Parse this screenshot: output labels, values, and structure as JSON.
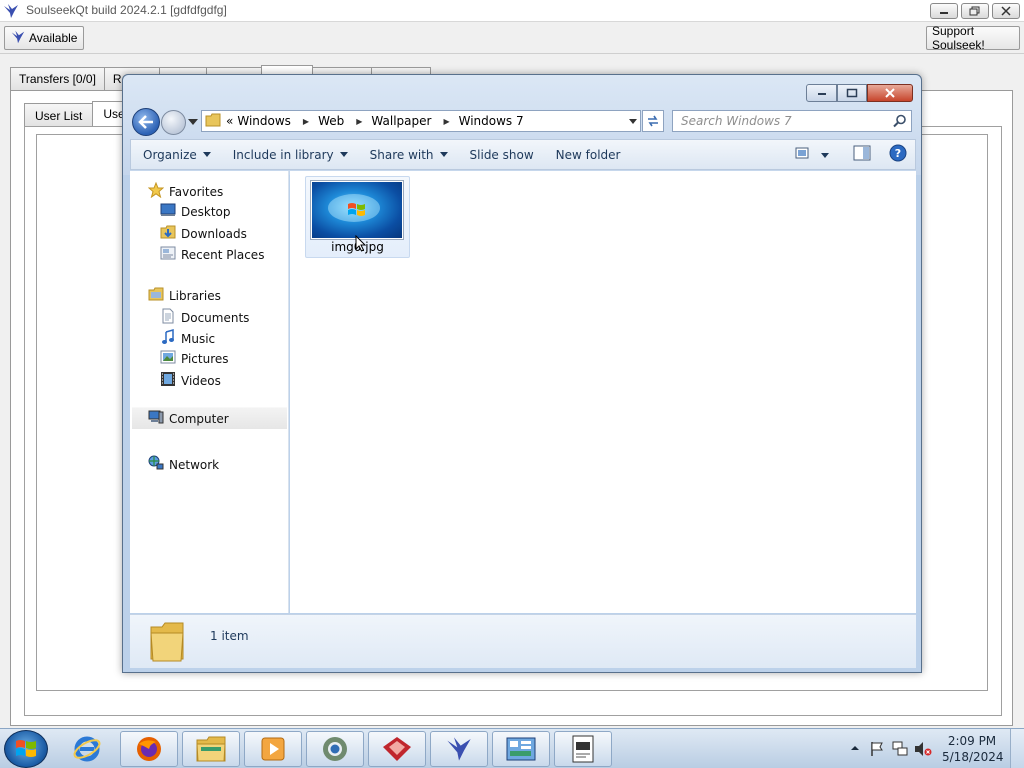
{
  "soulseek": {
    "title": "SoulseekQt build 2024.2.1 [gdfdfgdfg]",
    "available_label": "Available",
    "support_label": "Support Soulseek!",
    "tabs": [
      {
        "label": "Transfers [0/0]"
      },
      {
        "label": "R"
      },
      {
        "label": ""
      },
      {
        "label": ""
      },
      {
        "label": ""
      },
      {
        "label": ""
      },
      {
        "label": ""
      }
    ],
    "subtabs": [
      {
        "label": "User List"
      },
      {
        "label": "User"
      }
    ]
  },
  "explorer": {
    "breadcrumb": [
      "Windows",
      "Web",
      "Wallpaper",
      "Windows 7"
    ],
    "breadcrumb_prefix": "«",
    "search_placeholder": "Search Windows 7",
    "commands": {
      "organize": "Organize",
      "include_in_library": "Include in library",
      "share_with": "Share with",
      "slide_show": "Slide show",
      "new_folder": "New folder"
    },
    "nav": {
      "favorites": "Favorites",
      "desktop": "Desktop",
      "downloads": "Downloads",
      "recent_places": "Recent Places",
      "libraries": "Libraries",
      "documents": "Documents",
      "music": "Music",
      "pictures": "Pictures",
      "videos": "Videos",
      "computer": "Computer",
      "network": "Network"
    },
    "file": {
      "name": "img0.jpg"
    },
    "item_count": "1 item"
  },
  "taskbar": {
    "time": "2:09 PM",
    "date": "5/18/2024",
    "apps": [
      "internet-explorer",
      "firefox",
      "file-explorer",
      "media-player",
      "chrome",
      "filezilla",
      "soulseek",
      "control-panel",
      "certificate"
    ]
  },
  "colors": {
    "accent": "#1e395b",
    "window_frame": "#bcd1ea",
    "close_button": "#c7452c"
  }
}
